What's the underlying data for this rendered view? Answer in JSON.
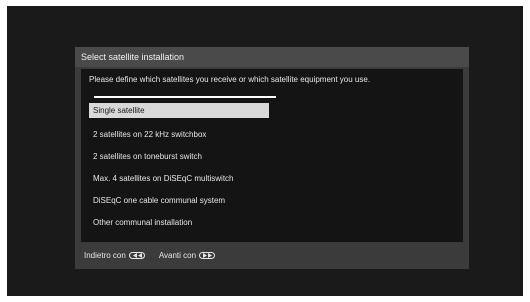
{
  "dialog": {
    "title": "Select satellite installation",
    "prompt": "Please define which satellites you receive or which satellite equipment you use.",
    "options": [
      {
        "label": "Single satellite",
        "selected": true
      },
      {
        "label": "2 satellites on 22 kHz switchbox",
        "selected": false
      },
      {
        "label": "2 satellites on toneburst switch",
        "selected": false
      },
      {
        "label": "Max. 4 satellites on DiSEqC multiswitch",
        "selected": false
      },
      {
        "label": "DiSEqC one cable communal system",
        "selected": false
      },
      {
        "label": "Other communal installation",
        "selected": false
      }
    ]
  },
  "footer": {
    "back_label": "Indietro con",
    "back_icon": "rewind-key-icon",
    "next_label": "Avanti con",
    "next_icon": "fast-forward-key-icon"
  },
  "colors": {
    "background": "#1a1a1a",
    "dialog": "#3b3b3b",
    "title_bar": "#4a4a4a",
    "content": "#141414",
    "selected": "#d9d9d9"
  }
}
